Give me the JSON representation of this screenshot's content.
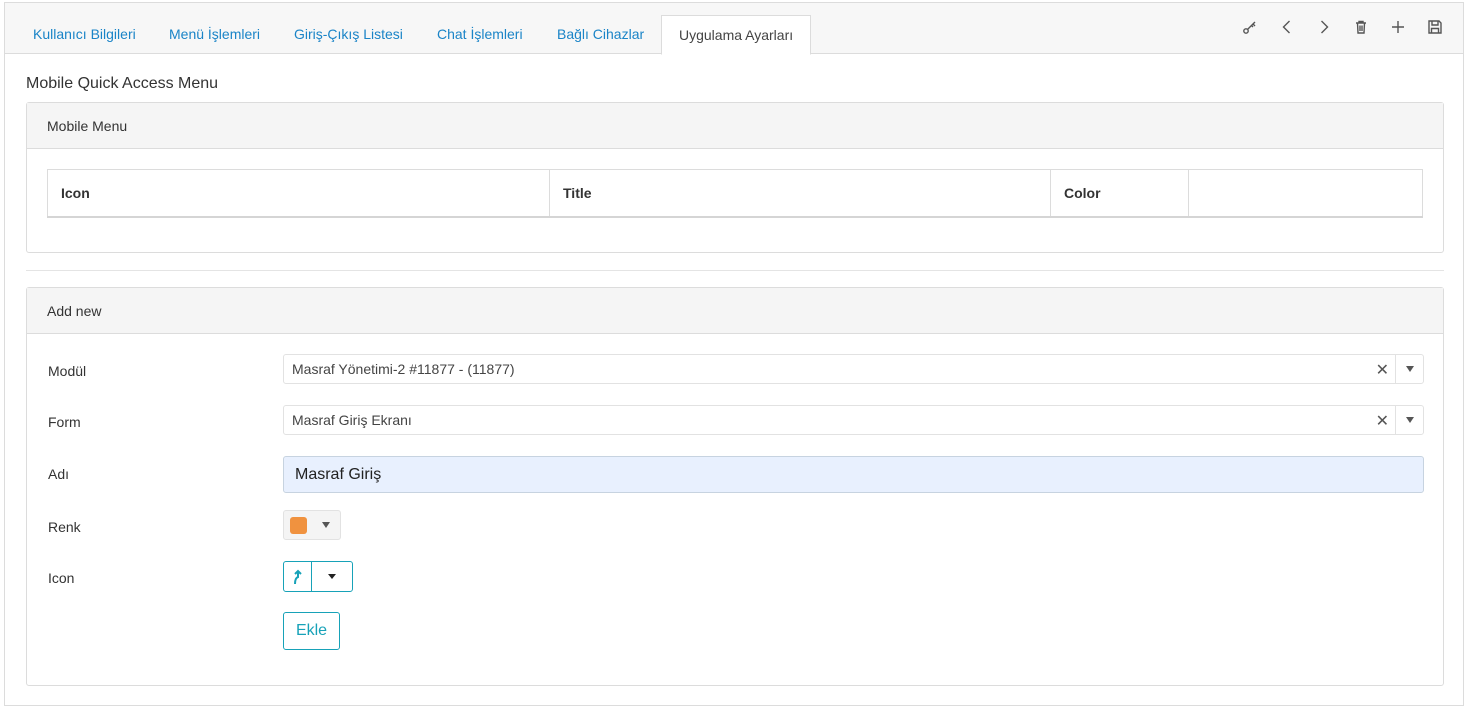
{
  "tabs": [
    {
      "label": "Kullanıcı Bilgileri"
    },
    {
      "label": "Menü İşlemleri"
    },
    {
      "label": "Giriş-Çıkış Listesi"
    },
    {
      "label": "Chat İşlemleri"
    },
    {
      "label": "Bağlı Cihazlar"
    },
    {
      "label": "Uygulama Ayarları"
    }
  ],
  "active_tab": "Uygulama Ayarları",
  "toolbar": [
    "key-icon",
    "chevron-left-icon",
    "chevron-right-icon",
    "trash-icon",
    "plus-icon",
    "save-icon"
  ],
  "section_title": "Mobile Quick Access Menu",
  "mobile_menu": {
    "title": "Mobile Menu",
    "columns": [
      "Icon",
      "Title",
      "Color",
      ""
    ]
  },
  "add_new": {
    "title": "Add new",
    "modul": {
      "label": "Modül",
      "value": "Masraf Yönetimi-2 #11877 - (11877)"
    },
    "form": {
      "label": "Form",
      "value": "Masraf Giriş Ekranı"
    },
    "adi": {
      "label": "Adı",
      "value": "Masraf Giriş"
    },
    "renk": {
      "label": "Renk",
      "color": "#f0923f"
    },
    "icon": {
      "label": "Icon",
      "icon_name": "arrow-up-turn-icon"
    },
    "submit_label": "Ekle"
  },
  "colors": {
    "accent": "#1a84c7",
    "button": "#17a2b8",
    "input_fill": "#e8f0fe"
  }
}
